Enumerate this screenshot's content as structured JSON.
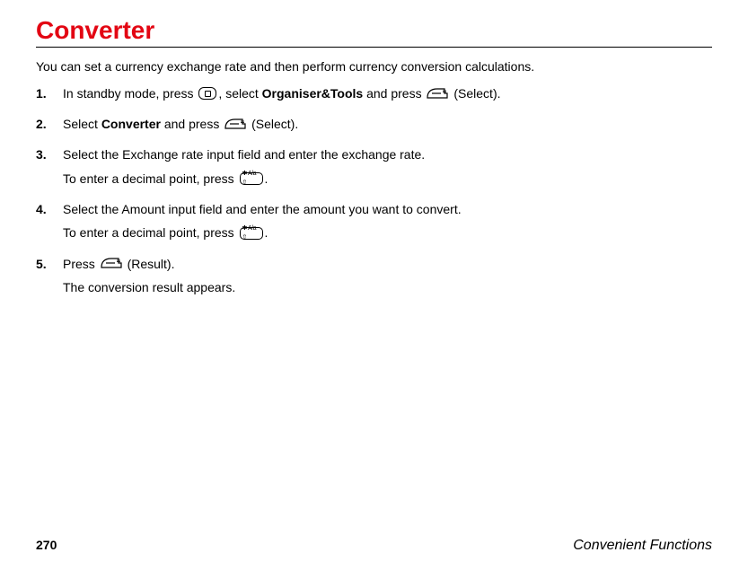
{
  "title": "Converter",
  "intro": "You can set a currency exchange rate and then perform currency conversion calculations.",
  "steps": {
    "s1": {
      "pre": "In standby mode, press ",
      "mid": ", select ",
      "bold1": "Organiser&Tools",
      "post": " and press ",
      "tail": " (Select)."
    },
    "s2": {
      "pre": "Select ",
      "bold1": "Converter",
      "mid": " and press ",
      "tail": " (Select)."
    },
    "s3": {
      "main": "Select the Exchange rate input field and enter the exchange rate.",
      "sub_pre": "To enter a decimal point, press ",
      "sub_tail": "."
    },
    "s4": {
      "main": "Select the Amount input field and enter the amount you want to convert.",
      "sub_pre": "To enter a decimal point, press ",
      "sub_tail": "."
    },
    "s5": {
      "pre": "Press ",
      "tail": " (Result).",
      "sub": "The conversion result appears."
    }
  },
  "starKeyLabel": "✱ A/a ⇧",
  "footer": {
    "page": "270",
    "section": "Convenient Functions"
  }
}
